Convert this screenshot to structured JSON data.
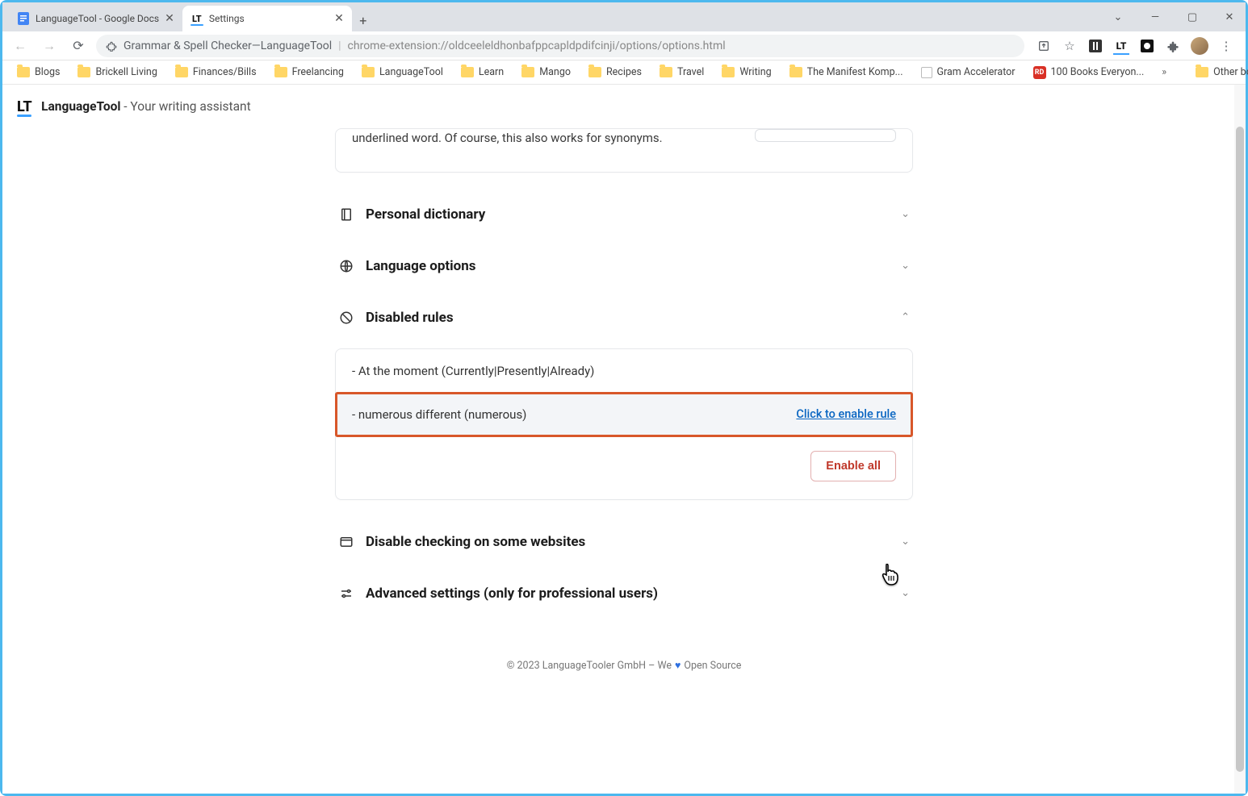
{
  "tabs": [
    {
      "title": "LanguageTool - Google Docs",
      "favicon": "docs"
    },
    {
      "title": "Settings",
      "favicon": "lt"
    }
  ],
  "window": {
    "chevron": "⌄",
    "min": "—",
    "max": "▢",
    "close": "✕"
  },
  "nav": {
    "new_tab": "+"
  },
  "url": {
    "ext_label": "Grammar & Spell Checker—LanguageTool",
    "path": "chrome-extension://oldceeleldhonbafppcapldpdifcinji/options/options.html"
  },
  "bookmarks": [
    {
      "label": "Blogs",
      "type": "folder"
    },
    {
      "label": "Brickell Living",
      "type": "folder"
    },
    {
      "label": "Finances/Bills",
      "type": "folder"
    },
    {
      "label": "Freelancing",
      "type": "folder"
    },
    {
      "label": "LanguageTool",
      "type": "folder"
    },
    {
      "label": "Learn",
      "type": "folder"
    },
    {
      "label": "Mango",
      "type": "folder"
    },
    {
      "label": "Recipes",
      "type": "folder"
    },
    {
      "label": "Travel",
      "type": "folder"
    },
    {
      "label": "Writing",
      "type": "folder"
    },
    {
      "label": "The Manifest Komp...",
      "type": "folder"
    },
    {
      "label": "Gram Accelerator",
      "type": "page"
    },
    {
      "label": "100 Books Everyon...",
      "type": "red"
    }
  ],
  "bookmarks_overflow": "»",
  "other_bookmarks": "Other bookmarks",
  "header": {
    "brand": "LanguageTool",
    "tagline": " - Your writing assistant"
  },
  "snippet_text": "underlined word. Of course, this also works for synonyms.",
  "sections": {
    "dictionary": "Personal dictionary",
    "language": "Language options",
    "disabled": "Disabled rules",
    "websites": "Disable checking on some websites",
    "advanced": "Advanced settings (only for professional users)"
  },
  "rules": [
    {
      "text": "At the moment (Currently|Presently|Already)"
    },
    {
      "text": "numerous different (numerous)",
      "enable_label": "Click to enable rule",
      "highlighted": true
    }
  ],
  "enable_all": "Enable all",
  "footer": {
    "pre": "© 2023 LanguageTooler GmbH – We",
    "heart": "♥",
    "post": "Open Source"
  }
}
